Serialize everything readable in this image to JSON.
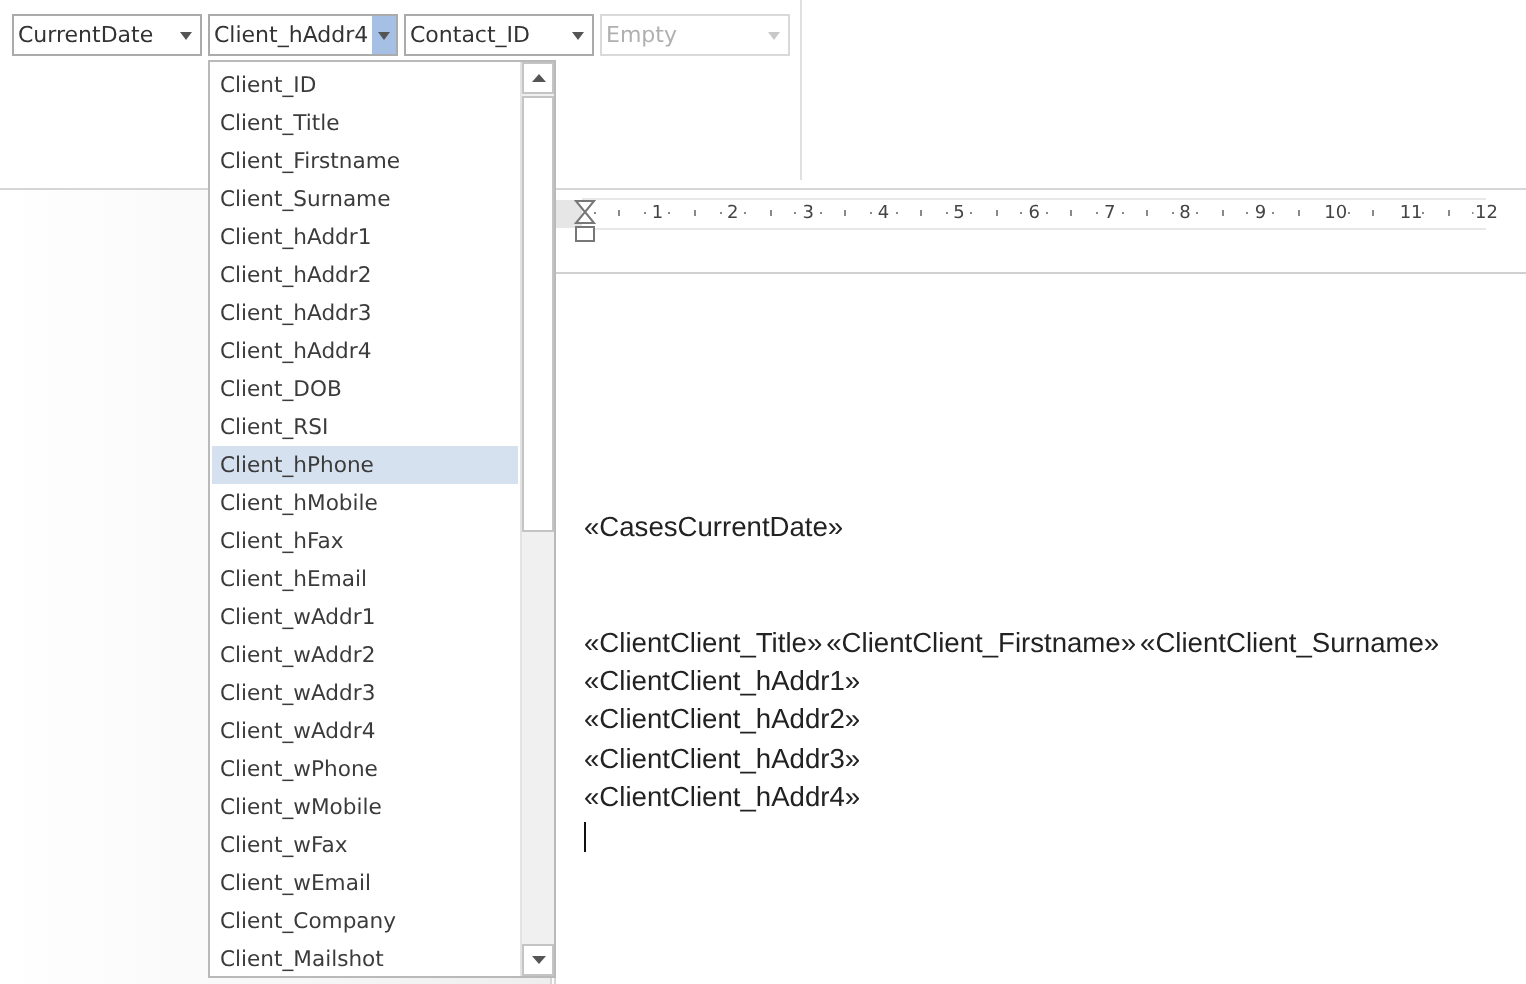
{
  "combos": [
    {
      "value": "CurrentDate",
      "active": false,
      "disabled": false
    },
    {
      "value": "Client_hAddr4",
      "active": true,
      "disabled": false
    },
    {
      "value": "Contact_ID",
      "active": false,
      "disabled": false
    },
    {
      "placeholder": "Empty",
      "active": false,
      "disabled": true
    }
  ],
  "dropdown": {
    "items": [
      {
        "label": "Client_ID",
        "selected": false
      },
      {
        "label": "Client_Title",
        "selected": false
      },
      {
        "label": "Client_Firstname",
        "selected": false
      },
      {
        "label": "Client_Surname",
        "selected": false
      },
      {
        "label": "Client_hAddr1",
        "selected": false
      },
      {
        "label": "Client_hAddr2",
        "selected": false
      },
      {
        "label": "Client_hAddr3",
        "selected": false
      },
      {
        "label": "Client_hAddr4",
        "selected": false
      },
      {
        "label": "Client_DOB",
        "selected": false
      },
      {
        "label": "Client_RSI",
        "selected": false
      },
      {
        "label": "Client_hPhone",
        "selected": true
      },
      {
        "label": "Client_hMobile",
        "selected": false
      },
      {
        "label": "Client_hFax",
        "selected": false
      },
      {
        "label": "Client_hEmail",
        "selected": false
      },
      {
        "label": "Client_wAddr1",
        "selected": false
      },
      {
        "label": "Client_wAddr2",
        "selected": false
      },
      {
        "label": "Client_wAddr3",
        "selected": false
      },
      {
        "label": "Client_wAddr4",
        "selected": false
      },
      {
        "label": "Client_wPhone",
        "selected": false
      },
      {
        "label": "Client_wMobile",
        "selected": false
      },
      {
        "label": "Client_wFax",
        "selected": false
      },
      {
        "label": "Client_wEmail",
        "selected": false
      },
      {
        "label": "Client_Company",
        "selected": false
      },
      {
        "label": "Client_Mailshot",
        "selected": false
      }
    ]
  },
  "ruler": {
    "numbers": [
      "1",
      "2",
      "3",
      "4",
      "5",
      "6",
      "7",
      "8",
      "9",
      "10",
      "11",
      "12"
    ]
  },
  "document": {
    "paragraphs": [
      {
        "kind": "text",
        "fields": [
          "«CasesCurrentDate»"
        ]
      },
      {
        "kind": "blank"
      },
      {
        "kind": "blank"
      },
      {
        "kind": "text",
        "fields": [
          "«ClientClient_Title»",
          "«ClientClient_Firstname»",
          "«ClientClient_Surname»"
        ]
      },
      {
        "kind": "text",
        "fields": [
          "«ClientClient_hAddr1»"
        ]
      },
      {
        "kind": "text",
        "fields": [
          "«ClientClient_hAddr2»"
        ]
      },
      {
        "kind": "text",
        "fields": [
          "«ClientClient_hAddr3»"
        ]
      },
      {
        "kind": "text",
        "fields": [
          "«ClientClient_hAddr4»"
        ]
      },
      {
        "kind": "cursor"
      }
    ]
  }
}
